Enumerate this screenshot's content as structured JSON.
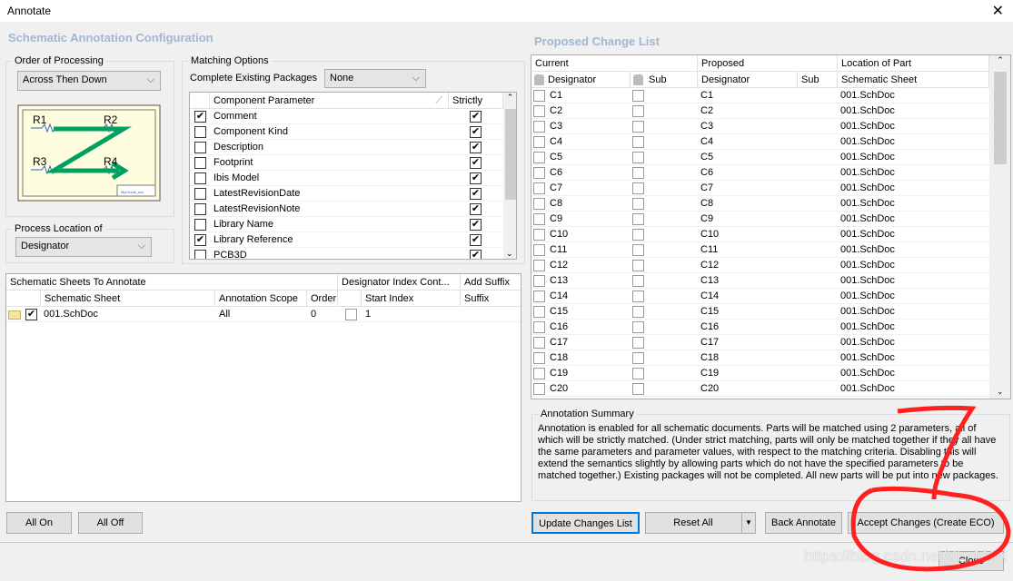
{
  "window": {
    "title": "Annotate",
    "close_glyph": "✕"
  },
  "config": {
    "title": "Schematic Annotation Configuration",
    "order_label": "Order of Processing",
    "order_value": "Across Then Down",
    "diagram": {
      "labels": [
        "R1",
        "R2",
        "R3",
        "R4"
      ],
      "caption": "MyCircuit_sch"
    },
    "location_label": "Process Location of",
    "location_value": "Designator",
    "matching_label": "Matching Options",
    "complete_label": "Complete Existing Packages",
    "complete_value": "None",
    "param_header": "Component Parameter",
    "strict_header": "Strictly",
    "params": [
      {
        "name": "Comment",
        "checked": true,
        "strict": true
      },
      {
        "name": "Component Kind",
        "checked": false,
        "strict": true
      },
      {
        "name": "Description",
        "checked": false,
        "strict": true
      },
      {
        "name": "Footprint",
        "checked": false,
        "strict": true
      },
      {
        "name": "Ibis Model",
        "checked": false,
        "strict": true
      },
      {
        "name": "LatestRevisionDate",
        "checked": false,
        "strict": true
      },
      {
        "name": "LatestRevisionNote",
        "checked": false,
        "strict": true
      },
      {
        "name": "Library Name",
        "checked": false,
        "strict": true
      },
      {
        "name": "Library Reference",
        "checked": true,
        "strict": true
      },
      {
        "name": "PCB3D",
        "checked": false,
        "strict": true
      }
    ]
  },
  "sheets": {
    "h_sheets": "Schematic Sheets To Annotate",
    "h_index": "Designator Index Cont...",
    "h_suffix": "Add Suffix",
    "c_sheet": "Schematic Sheet",
    "c_scope": "Annotation Scope",
    "c_order": "Order",
    "c_start": "Start Index",
    "c_suffix": "Suffix",
    "rows": [
      {
        "sheet": "001.SchDoc",
        "checked": true,
        "scope": "All",
        "order": "0",
        "start": "1",
        "suffix": ""
      }
    ]
  },
  "buttons": {
    "all_on": "All On",
    "all_off": "All Off",
    "update": "Update Changes List",
    "reset": "Reset All",
    "back": "Back Annotate",
    "accept": "Accept Changes (Create ECO)",
    "close": "Close"
  },
  "changes": {
    "title": "Proposed Change List",
    "h_current": "Current",
    "h_proposed": "Proposed",
    "h_location": "Location of Part",
    "c_des": "Designator",
    "c_sub": "Sub",
    "c_pdes": "Designator",
    "c_psub": "Sub",
    "c_sheet": "Schematic Sheet",
    "rows": [
      {
        "cur": "C1",
        "prop": "C1",
        "sheet": "001.SchDoc"
      },
      {
        "cur": "C2",
        "prop": "C2",
        "sheet": "001.SchDoc"
      },
      {
        "cur": "C3",
        "prop": "C3",
        "sheet": "001.SchDoc"
      },
      {
        "cur": "C4",
        "prop": "C4",
        "sheet": "001.SchDoc"
      },
      {
        "cur": "C5",
        "prop": "C5",
        "sheet": "001.SchDoc"
      },
      {
        "cur": "C6",
        "prop": "C6",
        "sheet": "001.SchDoc"
      },
      {
        "cur": "C7",
        "prop": "C7",
        "sheet": "001.SchDoc"
      },
      {
        "cur": "C8",
        "prop": "C8",
        "sheet": "001.SchDoc"
      },
      {
        "cur": "C9",
        "prop": "C9",
        "sheet": "001.SchDoc"
      },
      {
        "cur": "C10",
        "prop": "C10",
        "sheet": "001.SchDoc"
      },
      {
        "cur": "C11",
        "prop": "C11",
        "sheet": "001.SchDoc"
      },
      {
        "cur": "C12",
        "prop": "C12",
        "sheet": "001.SchDoc"
      },
      {
        "cur": "C13",
        "prop": "C13",
        "sheet": "001.SchDoc"
      },
      {
        "cur": "C14",
        "prop": "C14",
        "sheet": "001.SchDoc"
      },
      {
        "cur": "C15",
        "prop": "C15",
        "sheet": "001.SchDoc"
      },
      {
        "cur": "C16",
        "prop": "C16",
        "sheet": "001.SchDoc"
      },
      {
        "cur": "C17",
        "prop": "C17",
        "sheet": "001.SchDoc"
      },
      {
        "cur": "C18",
        "prop": "C18",
        "sheet": "001.SchDoc"
      },
      {
        "cur": "C19",
        "prop": "C19",
        "sheet": "001.SchDoc"
      },
      {
        "cur": "C20",
        "prop": "C20",
        "sheet": "001.SchDoc"
      }
    ]
  },
  "summary": {
    "label": "Annotation Summary",
    "text": "Annotation is enabled for all schematic documents. Parts will be matched using 2 parameters, all of which will be strictly matched. (Under strict matching, parts will only be matched together if they all have the same parameters and parameter values, with respect to the matching criteria. Disabling this will extend the semantics slightly by allowing parts which do not have the specified parameters to be matched together.) Existing packages will not be completed. All new parts will be put into new packages."
  },
  "annotation": {
    "mark": "7",
    "color": "#ff2020"
  },
  "watermark": "https://blog.csdn.net/XL_MAX",
  "colors": {
    "accent": "#0078d7",
    "section_title": "#9fb6d4",
    "arrow": "#00a060"
  }
}
